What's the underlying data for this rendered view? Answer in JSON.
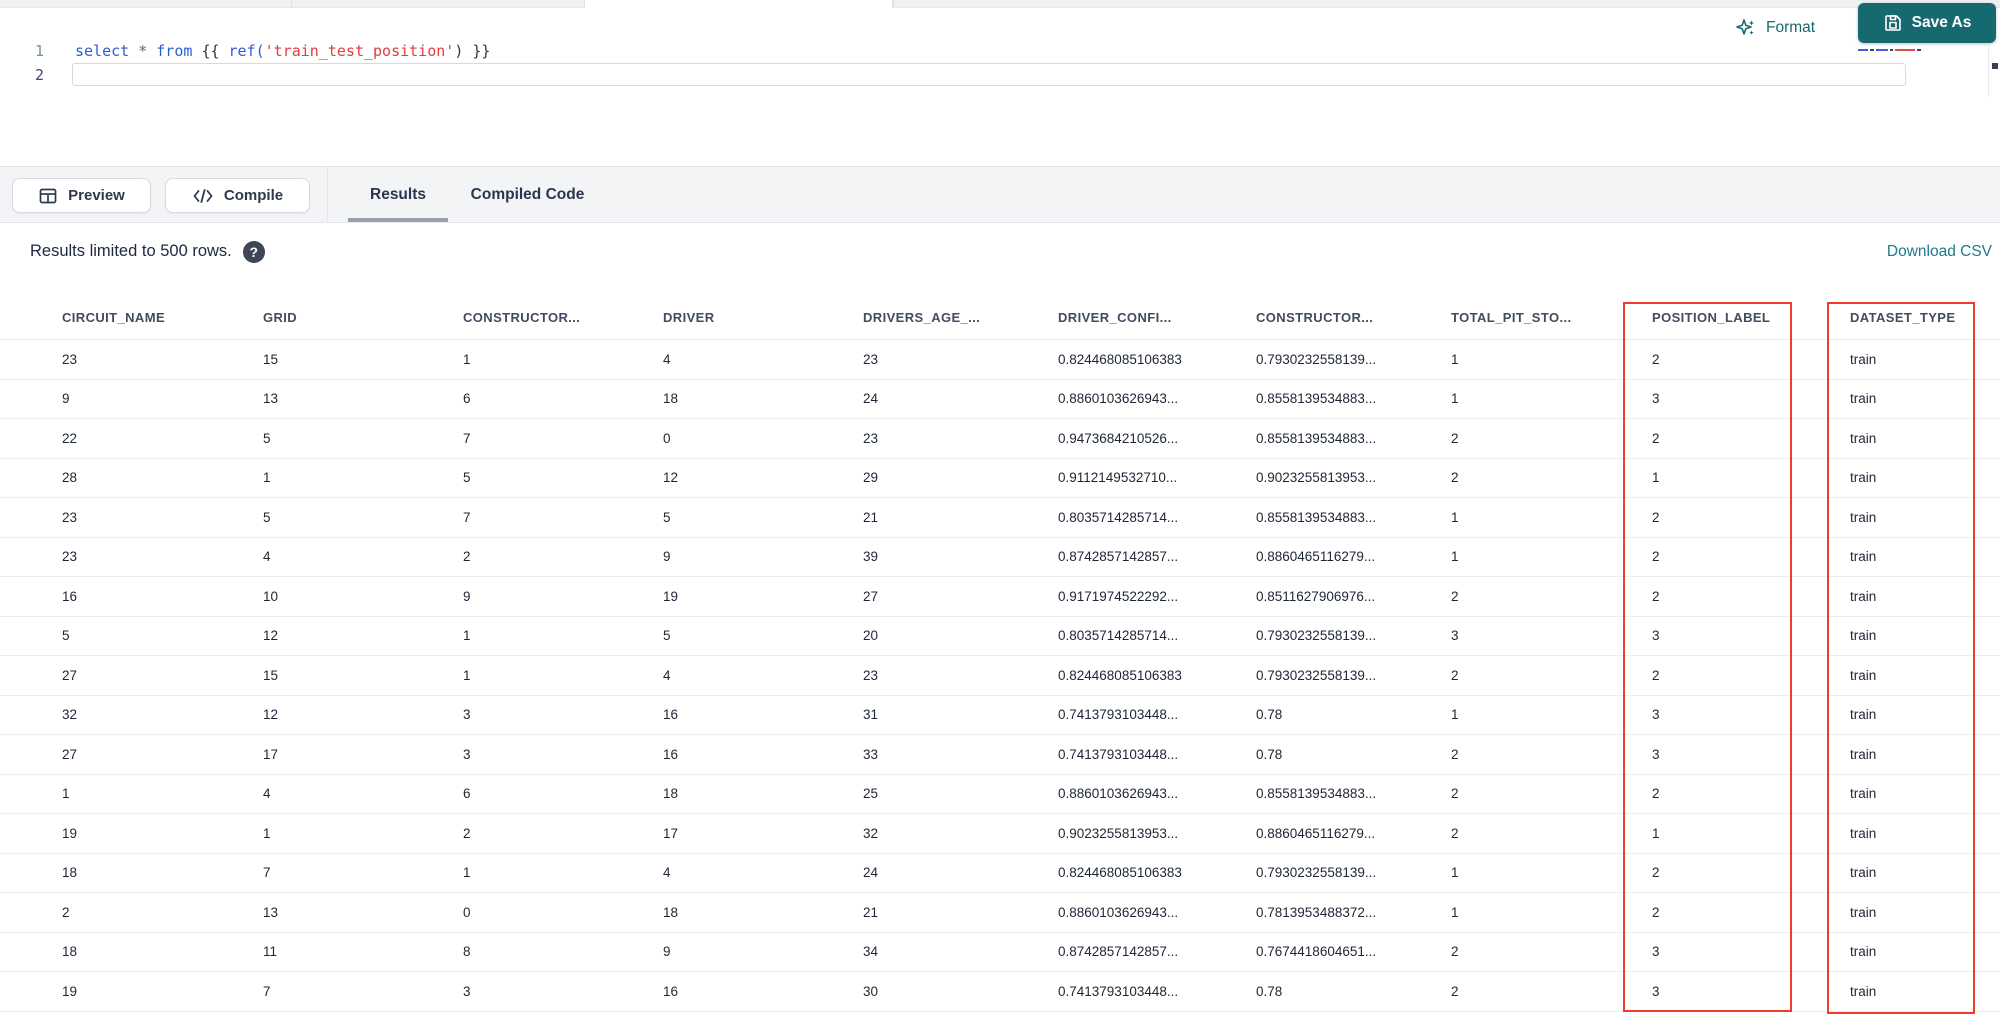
{
  "editor": {
    "lines": [
      {
        "number": "1",
        "tokens": [
          {
            "t": "select",
            "c": "kw"
          },
          {
            "t": " ",
            "c": "plain"
          },
          {
            "t": "*",
            "c": "op"
          },
          {
            "t": " ",
            "c": "plain"
          },
          {
            "t": "from",
            "c": "kw"
          },
          {
            "t": " ",
            "c": "plain"
          },
          {
            "t": "{{",
            "c": "brace"
          },
          {
            "t": " ",
            "c": "plain"
          },
          {
            "t": "ref",
            "c": "fn"
          },
          {
            "t": "(",
            "c": "fn"
          },
          {
            "t": "'train_test_position'",
            "c": "str"
          },
          {
            "t": ")",
            "c": "brace"
          },
          {
            "t": " ",
            "c": "plain"
          },
          {
            "t": "}}",
            "c": "brace"
          }
        ]
      },
      {
        "number": "2",
        "tokens": []
      }
    ]
  },
  "actions": {
    "format": "Format",
    "save_as": "Save As"
  },
  "toolbar": {
    "preview": "Preview",
    "compile": "Compile"
  },
  "tabs": [
    {
      "label": "Results",
      "active": true
    },
    {
      "label": "Compiled Code",
      "active": false
    }
  ],
  "results_bar": {
    "limit_text": "Results limited to 500 rows.",
    "help_glyph": "?",
    "download": "Download CSV"
  },
  "table": {
    "columns": [
      "CIRCUIT_NAME",
      "GRID",
      "CONSTRUCTOR...",
      "DRIVER",
      "DRIVERS_AGE_...",
      "DRIVER_CONFI...",
      "CONSTRUCTOR...",
      "TOTAL_PIT_STO...",
      "POSITION_LABEL",
      "DATASET_TYPE"
    ],
    "highlighted_columns": [
      "POSITION_LABEL",
      "DATASET_TYPE"
    ],
    "rows": [
      [
        "23",
        "15",
        "1",
        "4",
        "23",
        "0.824468085106383",
        "0.7930232558139...",
        "1",
        "2",
        "train"
      ],
      [
        "9",
        "13",
        "6",
        "18",
        "24",
        "0.8860103626943...",
        "0.8558139534883...",
        "1",
        "3",
        "train"
      ],
      [
        "22",
        "5",
        "7",
        "0",
        "23",
        "0.9473684210526...",
        "0.8558139534883...",
        "2",
        "2",
        "train"
      ],
      [
        "28",
        "1",
        "5",
        "12",
        "29",
        "0.9112149532710...",
        "0.9023255813953...",
        "2",
        "1",
        "train"
      ],
      [
        "23",
        "5",
        "7",
        "5",
        "21",
        "0.8035714285714...",
        "0.8558139534883...",
        "1",
        "2",
        "train"
      ],
      [
        "23",
        "4",
        "2",
        "9",
        "39",
        "0.8742857142857...",
        "0.8860465116279...",
        "1",
        "2",
        "train"
      ],
      [
        "16",
        "10",
        "9",
        "19",
        "27",
        "0.9171974522292...",
        "0.8511627906976...",
        "2",
        "2",
        "train"
      ],
      [
        "5",
        "12",
        "1",
        "5",
        "20",
        "0.8035714285714...",
        "0.7930232558139...",
        "3",
        "3",
        "train"
      ],
      [
        "27",
        "15",
        "1",
        "4",
        "23",
        "0.824468085106383",
        "0.7930232558139...",
        "2",
        "2",
        "train"
      ],
      [
        "32",
        "12",
        "3",
        "16",
        "31",
        "0.7413793103448...",
        "0.78",
        "1",
        "3",
        "train"
      ],
      [
        "27",
        "17",
        "3",
        "16",
        "33",
        "0.7413793103448...",
        "0.78",
        "2",
        "3",
        "train"
      ],
      [
        "1",
        "4",
        "6",
        "18",
        "25",
        "0.8860103626943...",
        "0.8558139534883...",
        "2",
        "2",
        "train"
      ],
      [
        "19",
        "1",
        "2",
        "17",
        "32",
        "0.9023255813953...",
        "0.8860465116279...",
        "2",
        "1",
        "train"
      ],
      [
        "18",
        "7",
        "1",
        "4",
        "24",
        "0.824468085106383",
        "0.7930232558139...",
        "1",
        "2",
        "train"
      ],
      [
        "2",
        "13",
        "0",
        "18",
        "21",
        "0.8860103626943...",
        "0.7813953488372...",
        "1",
        "2",
        "train"
      ],
      [
        "18",
        "11",
        "8",
        "9",
        "34",
        "0.8742857142857...",
        "0.7674418604651...",
        "2",
        "3",
        "train"
      ],
      [
        "19",
        "7",
        "3",
        "16",
        "30",
        "0.7413793103448...",
        "0.78",
        "2",
        "3",
        "train"
      ]
    ]
  },
  "colors": {
    "accent_teal": "#15696f",
    "link_teal": "#1b7b8a",
    "highlight_red": "#f23b2c",
    "tab_underline": "#98a0ab"
  }
}
